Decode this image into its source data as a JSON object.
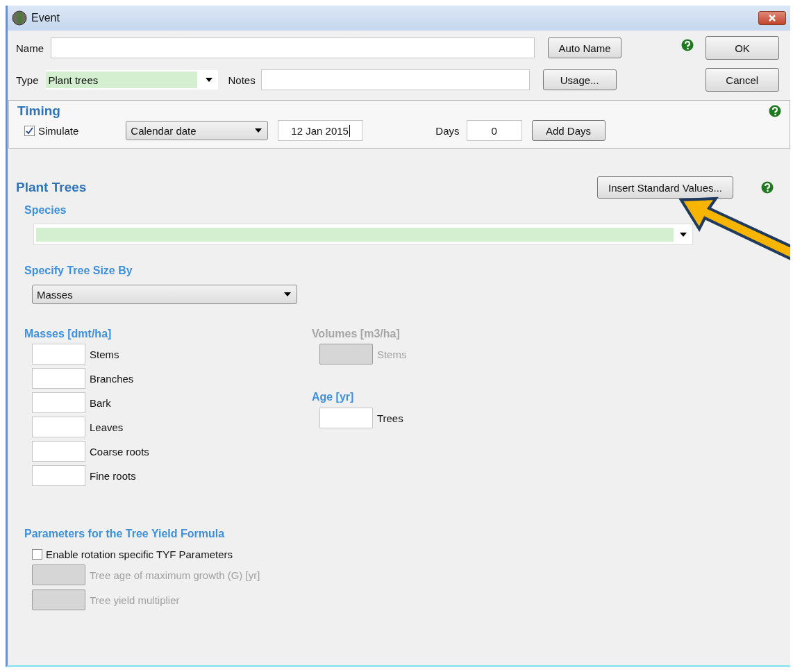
{
  "window": {
    "title": "Event"
  },
  "name": {
    "label": "Name"
  },
  "type": {
    "label": "Type",
    "value": "Plant trees"
  },
  "notes": {
    "label": "Notes"
  },
  "side_buttons": [
    "Auto Name",
    "Usage..."
  ],
  "dialog_buttons": [
    "OK",
    "Cancel"
  ],
  "timing": {
    "title": "Timing",
    "simulate": {
      "label": "Simulate",
      "checked": true
    },
    "date_mode": "Calendar date",
    "date": "12 Jan 2015",
    "days_label": "Days",
    "days": "0",
    "add_days": "Add Days"
  },
  "plant_trees": {
    "title": "Plant Trees",
    "insert_button": "Insert Standard Values...",
    "species_label": "Species",
    "size_label": "Specify Tree Size By",
    "size_by": "Masses",
    "masses": {
      "title": "Masses [dmt/ha]",
      "disabled": false,
      "fields": [
        "Stems",
        "Branches",
        "Bark",
        "Leaves",
        "Coarse roots",
        "Fine roots"
      ]
    },
    "volumes": {
      "title": "Volumes [m3/ha]",
      "disabled": true,
      "fields": [
        "Stems"
      ]
    },
    "age": {
      "title": "Age [yr]",
      "disabled": false,
      "fields": [
        "Trees"
      ]
    }
  },
  "tyf": {
    "title": "Parameters for the Tree Yield Formula",
    "enable": {
      "label": "Enable rotation specific TYF Parameters",
      "checked": false
    },
    "fields": [
      {
        "label": "Tree age of maximum growth (G) [yr]",
        "disabled": true
      },
      {
        "label": "Tree yield multiplier",
        "disabled": true
      }
    ]
  }
}
